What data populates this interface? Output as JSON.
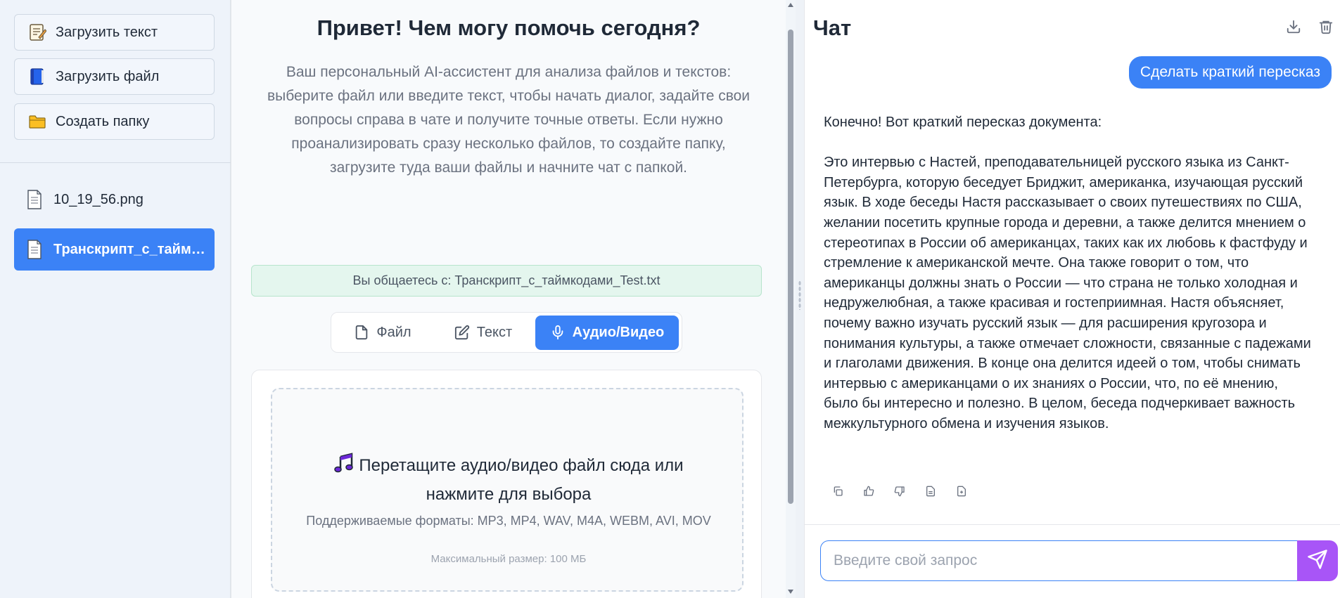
{
  "sidebar": {
    "buttons": [
      {
        "label": "Загрузить текст",
        "icon": "memo-icon"
      },
      {
        "label": "Загрузить файл",
        "icon": "blue-book-icon"
      },
      {
        "label": "Создать папку",
        "icon": "folder-icon"
      }
    ],
    "files": [
      {
        "label": "10_19_56.png",
        "icon": "document-icon",
        "active": false
      },
      {
        "label": "Транскрипт_с_таймкодами_Test.txt",
        "icon": "document-icon",
        "active": true
      }
    ]
  },
  "main": {
    "greeting": "Привет! Чем могу помочь сегодня?",
    "intro": "Ваш персональный AI-ассистент для анализа файлов и текстов: выберите файл или введите текст, чтобы начать диалог, задайте свои вопросы справа в чате и получите точные ответы. Если нужно проанализировать сразу несколько файлов, то создайте папку, загрузите туда ваши файлы и начните чат с папкой.",
    "talking_with": "Вы общаетесь с: Транскрипт_с_таймкодами_Test.txt",
    "tabs": [
      {
        "label": "Файл",
        "icon": "file-icon",
        "active": false
      },
      {
        "label": "Текст",
        "icon": "edit-icon",
        "active": false
      },
      {
        "label": "Аудио/Видео",
        "icon": "microphone-icon",
        "active": true
      }
    ],
    "dropzone": {
      "title": "Перетащите аудио/видео файл сюда или нажмите для выбора",
      "formats": "Поддерживаемые форматы: MP3, MP4, WAV, M4A, WEBM, AVI, MOV",
      "max_size": "Максимальный размер: 100 МБ",
      "icon": "music-note-icon"
    }
  },
  "chat": {
    "title": "Чат",
    "user_message": "Сделать краткий пересказ",
    "assistant_reply": "Конечно! Вот краткий пересказ документа:\n\nЭто интервью с Настей, преподавательницей русского языка из Санкт-Петербурга, которую беседует Бриджит, американка, изучающая русский язык. В ходе беседы Настя рассказывает о своих путешествиях по США, желании посетить крупные города и деревни, а также делится мнением о стереотипах в России об американцах, таких как их любовь к фастфуду и стремление к американской мечте. Она также говорит о том, что американцы должны знать о России — что страна не только холодная и недружелюбная, а также красивая и гостеприимная. Настя объясняет, почему важно изучать русский язык — для расширения кругозора и понимания культуры, а также отмечает сложности, связанные с падежами и глаголами движения. В конце она делится идеей о том, чтобы снимать интервью с американцами о их знаниях о России, что, по её мнению, было бы интересно и полезно. В целом, беседа подчеркивает важность межкультурного обмена и изучения языков.",
    "input_placeholder": "Введите свой запрос",
    "colors": {
      "accent": "#3b82f6",
      "send": "#a855f7"
    }
  }
}
